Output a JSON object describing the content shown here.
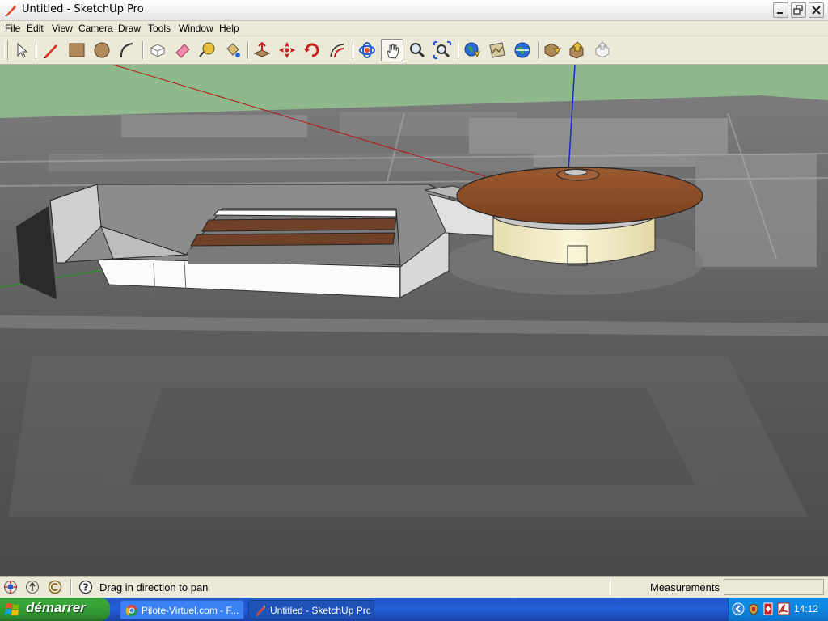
{
  "window": {
    "title": "Untitled - SketchUp Pro"
  },
  "menu": {
    "items": [
      "File",
      "Edit",
      "View",
      "Camera",
      "Draw",
      "Tools",
      "Window",
      "Help"
    ]
  },
  "toolbar": {
    "tools": [
      {
        "name": "select",
        "icon": "select-arrow-icon",
        "active": false
      },
      {
        "name": "pencil",
        "icon": "pencil-icon",
        "active": false
      },
      {
        "name": "rectangle",
        "icon": "rectangle-icon",
        "active": false
      },
      {
        "name": "circle",
        "icon": "circle-icon",
        "active": false
      },
      {
        "name": "arc",
        "icon": "arc-icon",
        "active": false
      },
      {
        "name": "make-component",
        "icon": "component-icon",
        "active": false
      },
      {
        "name": "eraser",
        "icon": "eraser-icon",
        "active": false
      },
      {
        "name": "tape-measure",
        "icon": "tape-measure-icon",
        "active": false
      },
      {
        "name": "paint-bucket",
        "icon": "paint-bucket-icon",
        "active": false
      },
      {
        "name": "push-pull",
        "icon": "push-pull-icon",
        "active": false
      },
      {
        "name": "move",
        "icon": "move-icon",
        "active": false
      },
      {
        "name": "rotate",
        "icon": "rotate-icon",
        "active": false
      },
      {
        "name": "offset",
        "icon": "offset-icon",
        "active": false
      },
      {
        "name": "orbit",
        "icon": "orbit-icon",
        "active": false
      },
      {
        "name": "pan",
        "icon": "pan-hand-icon",
        "active": true
      },
      {
        "name": "zoom",
        "icon": "zoom-icon",
        "active": false
      },
      {
        "name": "zoom-extents",
        "icon": "zoom-extents-icon",
        "active": false
      },
      {
        "name": "get-current-view",
        "icon": "earth-get-view-icon",
        "active": false
      },
      {
        "name": "toggle-terrain",
        "icon": "toggle-terrain-icon",
        "active": false
      },
      {
        "name": "place-model",
        "icon": "earth-place-model-icon",
        "active": false
      },
      {
        "name": "get-models",
        "icon": "get-models-icon",
        "active": false
      },
      {
        "name": "share-model",
        "icon": "share-model-icon",
        "active": false
      },
      {
        "name": "share-component",
        "icon": "share-component-icon",
        "active": false
      }
    ]
  },
  "statusbar": {
    "icons": [
      "geo-location-icon",
      "credits-icon",
      "copyright-icon",
      "help-question-icon"
    ],
    "message": "Drag in direction to pan",
    "measurements_label": "Measurements",
    "measurements_value": ""
  },
  "taskbar": {
    "start_label": "démarrer",
    "tasks": [
      {
        "label": "Pilote-Virtuel.com - F...",
        "icon": "chrome-icon",
        "active": false
      },
      {
        "label": "Untitled - SketchUp Pro",
        "icon": "sketchup-icon",
        "active": true
      }
    ],
    "tray_icons": [
      "tray-arrow-icon",
      "tray-security-icon",
      "tray-red-icon",
      "tray-acrobat-icon"
    ],
    "clock": "14:12"
  },
  "colors": {
    "sky": "#8fb88d",
    "roof_brown": "#8b4a26",
    "facade_cream": "#f3ecc4",
    "axis_red": "#b41414",
    "axis_blue": "#1428c8",
    "axis_green": "#1f9a1f"
  }
}
